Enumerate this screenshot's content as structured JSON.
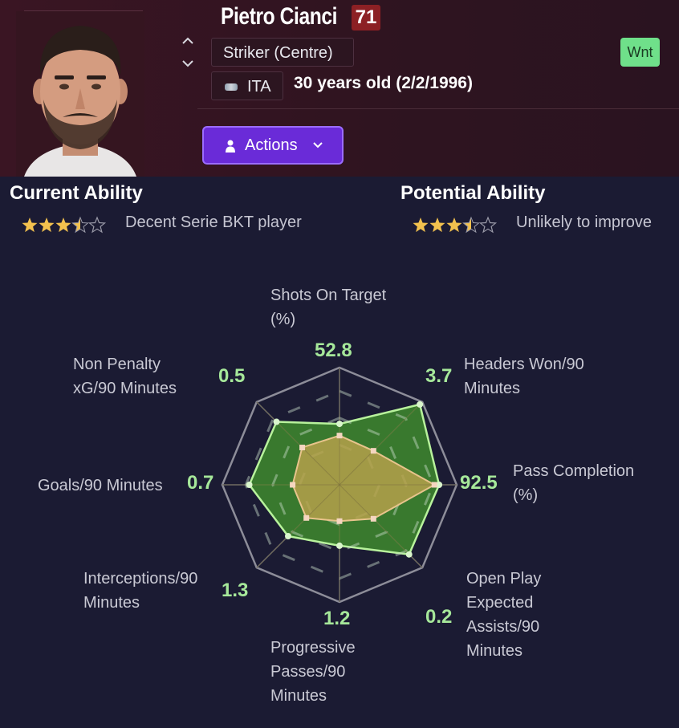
{
  "player": {
    "name": "Pietro Cianci",
    "rating": "71",
    "position": "Striker (Centre)",
    "nationality": "ITA",
    "age": "30 years old (2/2/1996)",
    "tag": "Wnt"
  },
  "actions": {
    "label": "Actions"
  },
  "current_ability": {
    "title": "Current Ability",
    "stars": 3.5,
    "max_stars": 5,
    "description": "Decent Serie BKT player"
  },
  "potential_ability": {
    "title": "Potential Ability",
    "stars": 3.5,
    "max_stars": 5,
    "description": "Unlikely to improve"
  },
  "colors": {
    "accent": "#6a2bd8",
    "rating_badge": "#8c2024",
    "wnt_badge": "#6fe08a",
    "value_text": "#a6e89a",
    "player_polygon": "#3e8a2e",
    "average_polygon": "#b5a04a",
    "star": "#f2c14e"
  },
  "chart_data": {
    "type": "radar",
    "axes": [
      {
        "label_lines": [
          "Shots On Target",
          "(%)"
        ],
        "value": "52.8",
        "player": 0.52,
        "average": 0.42
      },
      {
        "label_lines": [
          "Headers Won/90",
          "Minutes"
        ],
        "value": "3.7",
        "player": 0.97,
        "average": 0.41
      },
      {
        "label_lines": [
          "Pass Completion",
          "(%)"
        ],
        "value": "92.5",
        "player": 0.85,
        "average": 0.81
      },
      {
        "label_lines": [
          "Open Play",
          "Expected",
          "Assists/90",
          "Minutes"
        ],
        "value": "0.2",
        "player": 0.84,
        "average": 0.41
      },
      {
        "label_lines": [
          "Progressive",
          "Passes/90",
          "Minutes"
        ],
        "value": "1.2",
        "player": 0.52,
        "average": 0.31
      },
      {
        "label_lines": [
          "Interceptions/90",
          "Minutes"
        ],
        "value": "1.3",
        "player": 0.62,
        "average": 0.4
      },
      {
        "label_lines": [
          "Goals/90 Minutes"
        ],
        "value": "0.7",
        "player": 0.77,
        "average": 0.4
      },
      {
        "label_lines": [
          "Non Penalty",
          "xG/90 Minutes"
        ],
        "value": "0.5",
        "player": 0.76,
        "average": 0.45
      }
    ]
  }
}
